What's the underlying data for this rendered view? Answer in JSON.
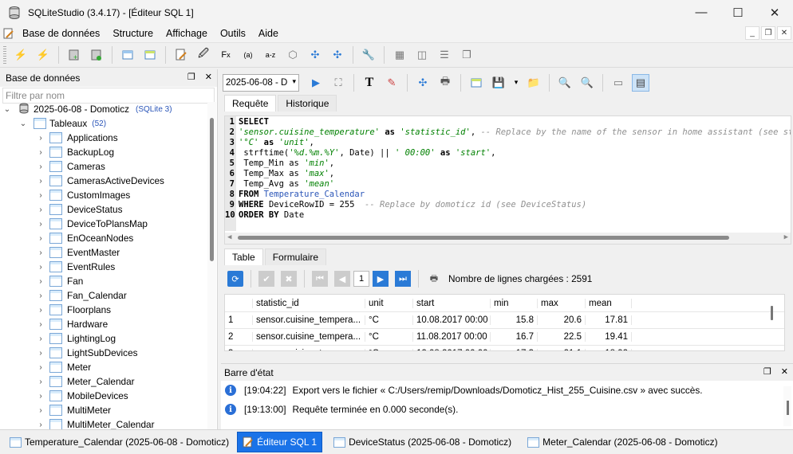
{
  "window": {
    "title": "SQLiteStudio (3.4.17) - [Éditeur SQL 1]"
  },
  "menu": [
    "Base de données",
    "Structure",
    "Affichage",
    "Outils",
    "Aide"
  ],
  "db_panel": {
    "title": "Base de données",
    "filter_placeholder": "Filtre par nom",
    "db_name": "2025-06-08 - Domoticz",
    "db_version": "(SQLite 3)",
    "tables_label": "Tableaux",
    "tables_count": "(52)",
    "tables": [
      "Applications",
      "BackupLog",
      "Cameras",
      "CamerasActiveDevices",
      "CustomImages",
      "DeviceStatus",
      "DeviceToPlansMap",
      "EnOceanNodes",
      "EventMaster",
      "EventRules",
      "Fan",
      "Fan_Calendar",
      "Floorplans",
      "Hardware",
      "LightingLog",
      "LightSubDevices",
      "Meter",
      "Meter_Calendar",
      "MobileDevices",
      "MultiMeter",
      "MultiMeter_Calendar"
    ]
  },
  "editor": {
    "db_select": "2025-06-08 - D",
    "tabs": [
      "Requête",
      "Historique"
    ],
    "lines": [
      "1",
      "2",
      "3",
      "4",
      "5",
      "6",
      "7",
      "8",
      "9",
      "10"
    ]
  },
  "results": {
    "tabs": [
      "Table",
      "Formulaire"
    ],
    "page": "1",
    "rows_loaded": "Nombre de lignes chargées : 2591",
    "columns": [
      "statistic_id",
      "unit",
      "start",
      "min",
      "max",
      "mean"
    ],
    "rows": [
      {
        "n": "1",
        "statistic_id": "sensor.cuisine_tempera...",
        "unit": "°C",
        "start": "10.08.2017 00:00",
        "min": "15.8",
        "max": "20.6",
        "mean": "17.81"
      },
      {
        "n": "2",
        "statistic_id": "sensor.cuisine_tempera...",
        "unit": "°C",
        "start": "11.08.2017 00:00",
        "min": "16.7",
        "max": "22.5",
        "mean": "19.41"
      },
      {
        "n": "3",
        "statistic_id": "sensor.cuisine_tempera...",
        "unit": "°C",
        "start": "12.08.2017 00:00",
        "min": "17.3",
        "max": "21.1",
        "mean": "18.92"
      }
    ]
  },
  "status": {
    "title": "Barre d'état",
    "messages": [
      {
        "time": "[19:04:22]",
        "text": "Export vers le fichier « C:/Users/remip/Downloads/Domoticz_Hist_255_Cuisine.csv » avec succès."
      },
      {
        "time": "[19:13:00]",
        "text": "Requête terminée en 0.000 seconde(s)."
      }
    ]
  },
  "taskbar": [
    "Temperature_Calendar (2025-06-08 - Domoticz)",
    "Éditeur SQL 1",
    "DeviceStatus (2025-06-08 - Domoticz)",
    "Meter_Calendar (2025-06-08 - Domoticz)"
  ],
  "sql": {
    "l1": "SELECT",
    "l2a": "'sensor.cuisine_temperature'",
    "l2b": " as ",
    "l2c": "'statistic_id'",
    "l2d": ", ",
    "l2e": "-- Replace by the name of the sensor in home assistant (see statis",
    "l3a": "'°C'",
    "l3b": " as ",
    "l3c": "'unit'",
    "l3d": ",",
    "l4a": " strftime(",
    "l4b": "'%d.%m.%Y'",
    "l4c": ", Date) || ",
    "l4d": "' 00:00'",
    "l4e": " as ",
    "l4f": "'start'",
    "l4g": ",",
    "l5a": " Temp_Min as ",
    "l5b": "'min'",
    "l5c": ",",
    "l6a": " Temp_Max as ",
    "l6b": "'max'",
    "l6c": ",",
    "l7a": " Temp_Avg as ",
    "l7b": "'mean'",
    "l8a": "FROM ",
    "l8b": "Temperature_Calendar",
    "l9a": "WHERE ",
    "l9b": "DeviceRowID = 255  ",
    "l9c": "-- Replace by domoticz id (see DeviceStatus)",
    "l10a": "ORDER BY ",
    "l10b": "Date"
  }
}
